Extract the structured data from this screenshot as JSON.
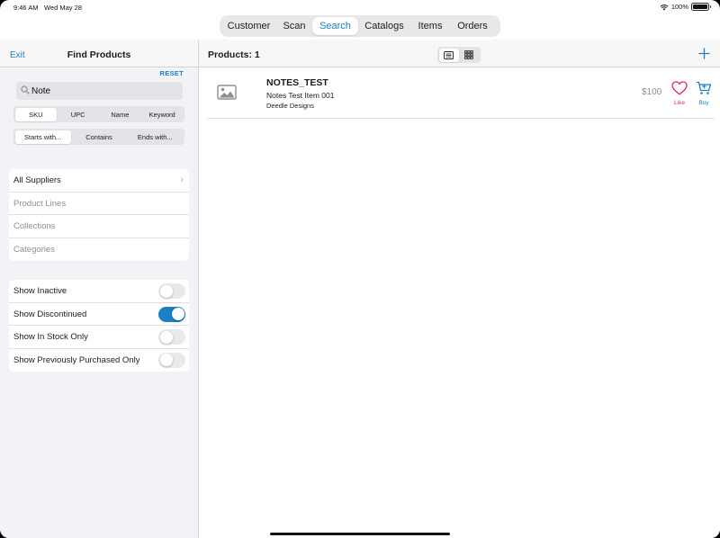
{
  "status_bar": {
    "time": "9:46 AM",
    "date": "Wed May 28",
    "battery": "100%"
  },
  "top_nav": {
    "tabs": [
      {
        "label": "Customer",
        "active": false
      },
      {
        "label": "Scan",
        "active": false
      },
      {
        "label": "Search",
        "active": true
      },
      {
        "label": "Catalogs",
        "active": false
      },
      {
        "label": "Items",
        "active": false
      },
      {
        "label": "Orders",
        "active": false
      }
    ]
  },
  "left_panel": {
    "exit_label": "Exit",
    "title": "Find Products",
    "reset_label": "RESET",
    "search": {
      "value": "Note",
      "icon": "search-icon"
    },
    "field_segments": [
      "SKU",
      "UPC",
      "Name",
      "Keyword"
    ],
    "field_selected": "SKU",
    "match_segments": [
      "Starts with...",
      "Contains",
      "Ends with..."
    ],
    "match_selected": "Starts with...",
    "filters": [
      "All Suppliers",
      "Product Lines",
      "Collections",
      "Categories"
    ],
    "toggles": [
      {
        "label": "Show Inactive",
        "on": false
      },
      {
        "label": "Show Discontinued",
        "on": true
      },
      {
        "label": "Show In Stock Only",
        "on": false
      },
      {
        "label": "Show Previously Purchased Only",
        "on": false
      }
    ]
  },
  "right_panel": {
    "products_count": "Products: 1",
    "view_modes": [
      "list-view-icon",
      "grid-view-icon"
    ],
    "add_icon": "plus-icon",
    "products": [
      {
        "sku": "NOTES_TEST",
        "description": "Notes Test Item 001",
        "supplier": "Deedle Designs",
        "price": "$100",
        "like_label": "Like",
        "buy_label": "Buy"
      }
    ]
  },
  "colors": {
    "accent": "#1a7fc4",
    "like": "#e0245e",
    "panel_bg": "#f2f2f7"
  }
}
